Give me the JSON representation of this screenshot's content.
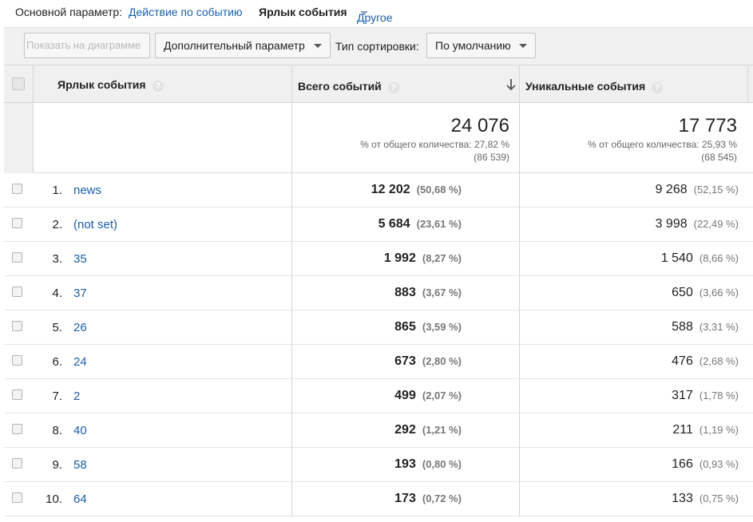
{
  "dimension_bar": {
    "primary_label": "Основной параметр:",
    "link_event_action": "Действие по событию",
    "active_event_label": "Ярлык события",
    "other": "Другое"
  },
  "toolbar": {
    "chart_button": "Показать на диаграмме",
    "secondary_dimension": "Дополнительный параметр",
    "sort_label": "Тип сортировки:",
    "sort_value": "По умолчанию"
  },
  "table": {
    "headers": {
      "event_label": "Ярлык события",
      "total_events": "Всего событий",
      "unique_events": "Уникальные события"
    },
    "help_glyph": "?",
    "totals": {
      "total_events": "24 076",
      "total_events_pct": "% от общего количества: 27,82 %",
      "total_events_of": "(86 539)",
      "unique_events": "17 773",
      "unique_events_pct": "% от общего количества: 25,93 %",
      "unique_events_of": "(68 545)"
    },
    "rows": [
      {
        "num": "1.",
        "label": "news",
        "total": "12 202",
        "total_pct": "(50,68 %)",
        "unique": "9 268",
        "unique_pct": "(52,15 %)"
      },
      {
        "num": "2.",
        "label": "(not set)",
        "total": "5 684",
        "total_pct": "(23,61 %)",
        "unique": "3 998",
        "unique_pct": "(22,49 %)"
      },
      {
        "num": "3.",
        "label": "35",
        "total": "1 992",
        "total_pct": "(8,27 %)",
        "unique": "1 540",
        "unique_pct": "(8,66 %)"
      },
      {
        "num": "4.",
        "label": "37",
        "total": "883",
        "total_pct": "(3,67 %)",
        "unique": "650",
        "unique_pct": "(3,66 %)"
      },
      {
        "num": "5.",
        "label": "26",
        "total": "865",
        "total_pct": "(3,59 %)",
        "unique": "588",
        "unique_pct": "(3,31 %)"
      },
      {
        "num": "6.",
        "label": "24",
        "total": "673",
        "total_pct": "(2,80 %)",
        "unique": "476",
        "unique_pct": "(2,68 %)"
      },
      {
        "num": "7.",
        "label": "2",
        "total": "499",
        "total_pct": "(2,07 %)",
        "unique": "317",
        "unique_pct": "(1,78 %)"
      },
      {
        "num": "8.",
        "label": "40",
        "total": "292",
        "total_pct": "(1,21 %)",
        "unique": "211",
        "unique_pct": "(1,19 %)"
      },
      {
        "num": "9.",
        "label": "58",
        "total": "193",
        "total_pct": "(0,80 %)",
        "unique": "166",
        "unique_pct": "(0,93 %)"
      },
      {
        "num": "10.",
        "label": "64",
        "total": "173",
        "total_pct": "(0,72 %)",
        "unique": "133",
        "unique_pct": "(0,75 %)"
      }
    ]
  },
  "colors": {
    "link": "#1a5fa8",
    "header_bg": "#f0f0f0",
    "toolbar_bg": "#f1f1f1"
  },
  "icons": {
    "help": "help-circle-icon",
    "sort": "arrow-down-icon",
    "dropdown": "caret-down-icon",
    "checkbox": "checkbox-icon"
  }
}
